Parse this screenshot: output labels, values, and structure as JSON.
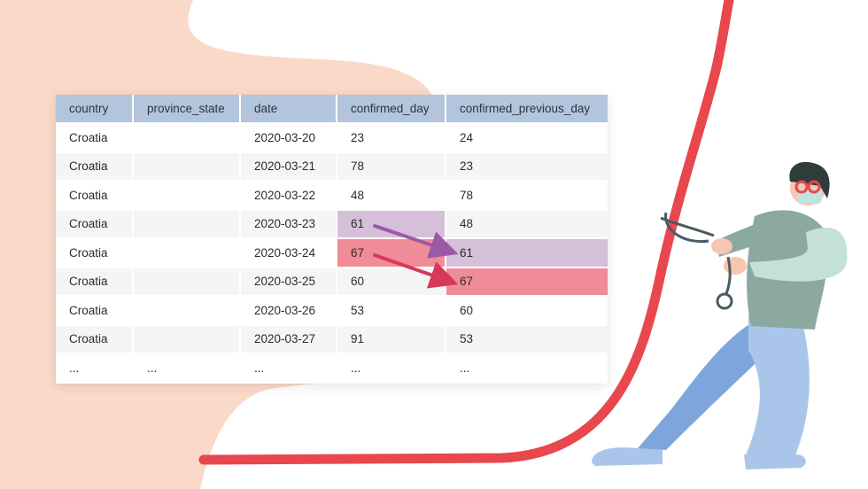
{
  "table": {
    "columns": [
      "country",
      "province_state",
      "date",
      "confirmed_day",
      "confirmed_previous_day"
    ],
    "rows": [
      [
        "Croatia",
        "",
        "2020-03-20",
        "23",
        "24"
      ],
      [
        "Croatia",
        "",
        "2020-03-21",
        "78",
        "23"
      ],
      [
        "Croatia",
        "",
        "2020-03-22",
        "48",
        "78"
      ],
      [
        "Croatia",
        "",
        "2020-03-23",
        "61",
        "48"
      ],
      [
        "Croatia",
        "",
        "2020-03-24",
        "67",
        "61"
      ],
      [
        "Croatia",
        "",
        "2020-03-25",
        "60",
        "67"
      ],
      [
        "Croatia",
        "",
        "2020-03-26",
        "53",
        "60"
      ],
      [
        "Croatia",
        "",
        "2020-03-27",
        "91",
        "53"
      ],
      [
        "...",
        "...",
        "...",
        "...",
        "..."
      ]
    ]
  },
  "colors": {
    "blob": "#fad9c9",
    "curve": "#e8474e",
    "header": "#b3c5dd",
    "highlight_purple": "#d6bfd8",
    "highlight_red": "#f08c97",
    "arrow_purple": "#9b59a6",
    "arrow_red": "#d63a58"
  },
  "illustration": {
    "figure": "doctor-with-stethoscope-pulling-curve",
    "icons": [
      "stethoscope-icon",
      "arrow-icon"
    ]
  }
}
